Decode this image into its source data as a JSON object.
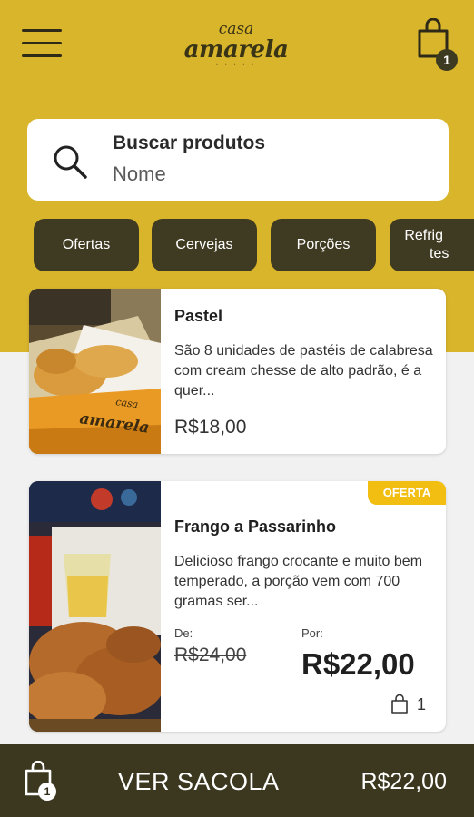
{
  "header": {
    "logo_small": "casa",
    "logo_big": "amarela",
    "cart_count": "1"
  },
  "search": {
    "title": "Buscar produtos",
    "placeholder": "Nome"
  },
  "categories": [
    "Ofertas",
    "Cervejas",
    "Porções",
    "Refrig",
    "tes"
  ],
  "products": [
    {
      "name": "Pastel",
      "description": "São 8 unidades de pastéis de calabresa com cream chesse de alto padrão, é a quer...",
      "price": "R$18,00",
      "photo_text_small": "casa",
      "photo_text_big": "amarela"
    },
    {
      "name": "Frango a Passarinho",
      "tag": "OFERTA",
      "description": "Delicioso frango crocante e muito bem temperado, a porção vem com 700 gramas ser...",
      "old_label": "De:",
      "old_price": "R$24,00",
      "new_label": "Por:",
      "new_price": "R$22,00",
      "quantity": "1"
    }
  ],
  "bottom_bar": {
    "label": "VER SACOLA",
    "total": "R$22,00",
    "count": "1"
  },
  "colors": {
    "brand_yellow": "#d9b52c",
    "chip_dark": "#3f3a22",
    "offer_yellow": "#f2be12",
    "bottom_bar": "#3b381f"
  }
}
